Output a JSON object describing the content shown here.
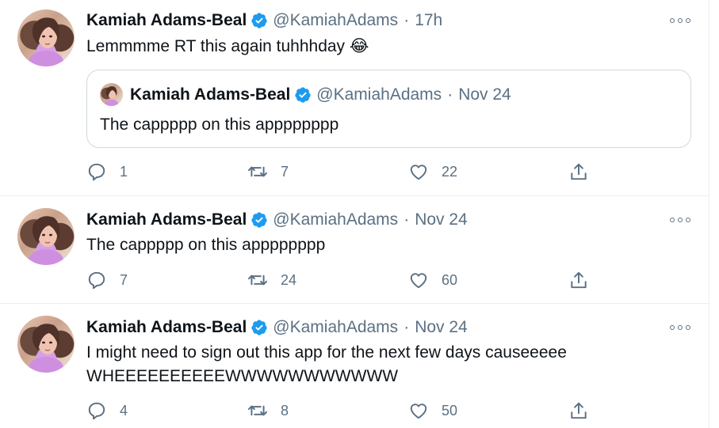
{
  "colors": {
    "text_primary": "#0f1419",
    "text_secondary": "#5b7083",
    "verified_blue": "#1d9bf0",
    "border": "#cfd9de",
    "divider": "#ebeef0"
  },
  "icons": {
    "verified": "verified-badge-icon",
    "more": "more-options-icon",
    "reply": "reply-icon",
    "retweet": "retweet-icon",
    "like": "heart-icon",
    "share": "share-icon"
  },
  "tweets": [
    {
      "author_name": "Kamiah Adams-Beal",
      "handle": "@KamiahAdams",
      "separator": "·",
      "time": "17h",
      "text": "Lemmmme RT this again tuhhhday 😂",
      "quoted": {
        "author_name": "Kamiah Adams-Beal",
        "handle": "@KamiahAdams",
        "separator": "·",
        "time": "Nov 24",
        "text": "The cappppp on this apppppppp"
      },
      "replies": "1",
      "retweets": "7",
      "likes": "22"
    },
    {
      "author_name": "Kamiah Adams-Beal",
      "handle": "@KamiahAdams",
      "separator": "·",
      "time": "Nov 24",
      "text": "The cappppp on this apppppppp",
      "replies": "7",
      "retweets": "24",
      "likes": "60"
    },
    {
      "author_name": "Kamiah Adams-Beal",
      "handle": "@KamiahAdams",
      "separator": "·",
      "time": "Nov 24",
      "text": "I might need to sign out this app for the next few days causeeeee\nWHEEEEEEEEEEWWWWWWWWWWW",
      "replies": "4",
      "retweets": "8",
      "likes": "50"
    }
  ]
}
